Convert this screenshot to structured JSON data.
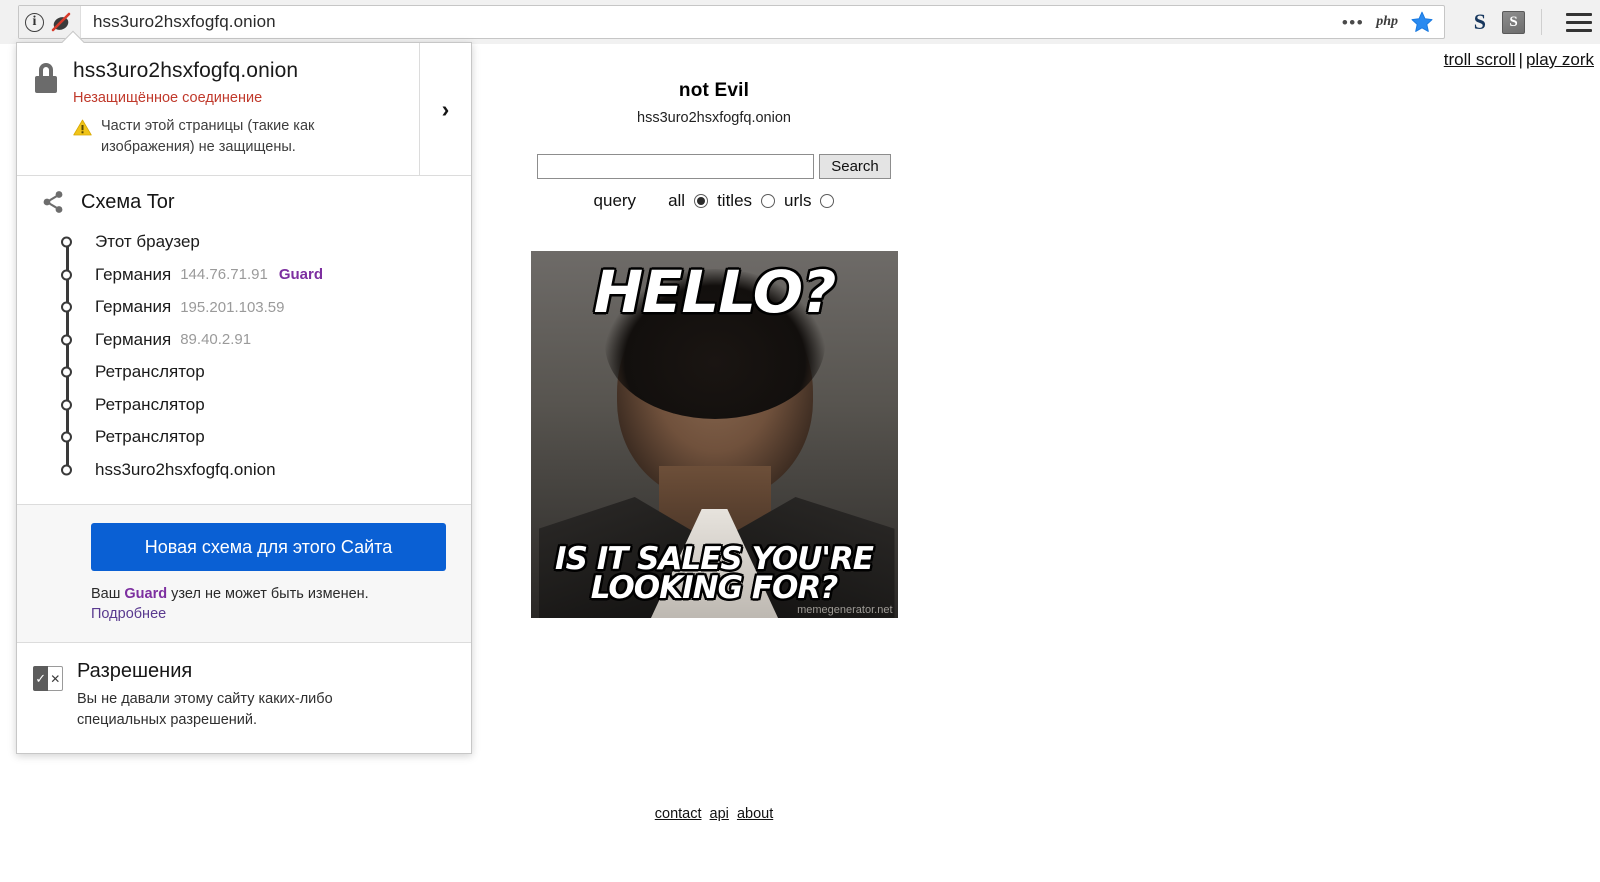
{
  "browser": {
    "url": "hss3uro2hsxfogfq.onion",
    "identity_icon": "info-icon",
    "noscript_icon": "noscript-icon",
    "overflow_icon": "dots-icon",
    "php_badge": "php",
    "bookmark_icon": "star-icon",
    "extensions": [
      {
        "name": "ext-s-icon",
        "label": "S"
      },
      {
        "name": "ext-square-icon",
        "label": "S"
      }
    ],
    "menu_icon": "hamburger-icon"
  },
  "popup": {
    "site": "hss3uro2hsxfogfq.onion",
    "connection_status": "Незащищённое соединение",
    "mixed_content_warning": "Части этой страницы (такие как изображения) не защищены.",
    "chevron": "›",
    "circuit": {
      "title": "Схема Tor",
      "nodes": [
        {
          "label": "Этот браузер",
          "ip": "",
          "tag": ""
        },
        {
          "label": "Германия",
          "ip": "144.76.71.91",
          "tag": "Guard"
        },
        {
          "label": "Германия",
          "ip": "195.201.103.59",
          "tag": ""
        },
        {
          "label": "Германия",
          "ip": "89.40.2.91",
          "tag": ""
        },
        {
          "label": "Ретранслятор",
          "ip": "",
          "tag": ""
        },
        {
          "label": "Ретранслятор",
          "ip": "",
          "tag": ""
        },
        {
          "label": "Ретранслятор",
          "ip": "",
          "tag": ""
        },
        {
          "label": "hss3uro2hsxfogfq.onion",
          "ip": "",
          "tag": ""
        }
      ]
    },
    "new_circuit_button": "Новая схема для этого Сайта",
    "guard_note_prefix": "Ваш ",
    "guard_note_tag": "Guard",
    "guard_note_suffix": " узел не может быть изменен.",
    "learn_more": "Подробнее",
    "permissions": {
      "title": "Разрешения",
      "description": "Вы не давали этому сайту каких-либо специальных разрешений.",
      "icon": "permissions-icon"
    }
  },
  "page": {
    "top_links": {
      "troll": "troll scroll",
      "separator": "|",
      "zork": "play zork"
    },
    "brand": "not Evil",
    "brand_sub": "hss3uro2hsxfogfq.onion",
    "search": {
      "value": "",
      "placeholder": "",
      "button": "Search",
      "query_label": "query",
      "options": [
        {
          "label": "all",
          "selected": true
        },
        {
          "label": "titles",
          "selected": false
        },
        {
          "label": "urls",
          "selected": false
        }
      ]
    },
    "meme": {
      "top_text": "HELLO?",
      "bottom_text": "IS IT SALES YOU'RE LOOKING FOR?",
      "watermark": "memegenerator.net",
      "alt": "lionel-richie-hello-meme"
    },
    "footer_links": [
      "contact",
      "api",
      "about"
    ]
  },
  "colors": {
    "accent_blue": "#0a60d4",
    "insecure_red": "#c0392b",
    "guard_purple": "#7d2fa0",
    "link_purple": "#5a3a8f",
    "warn_yellow": "#f0c419"
  }
}
